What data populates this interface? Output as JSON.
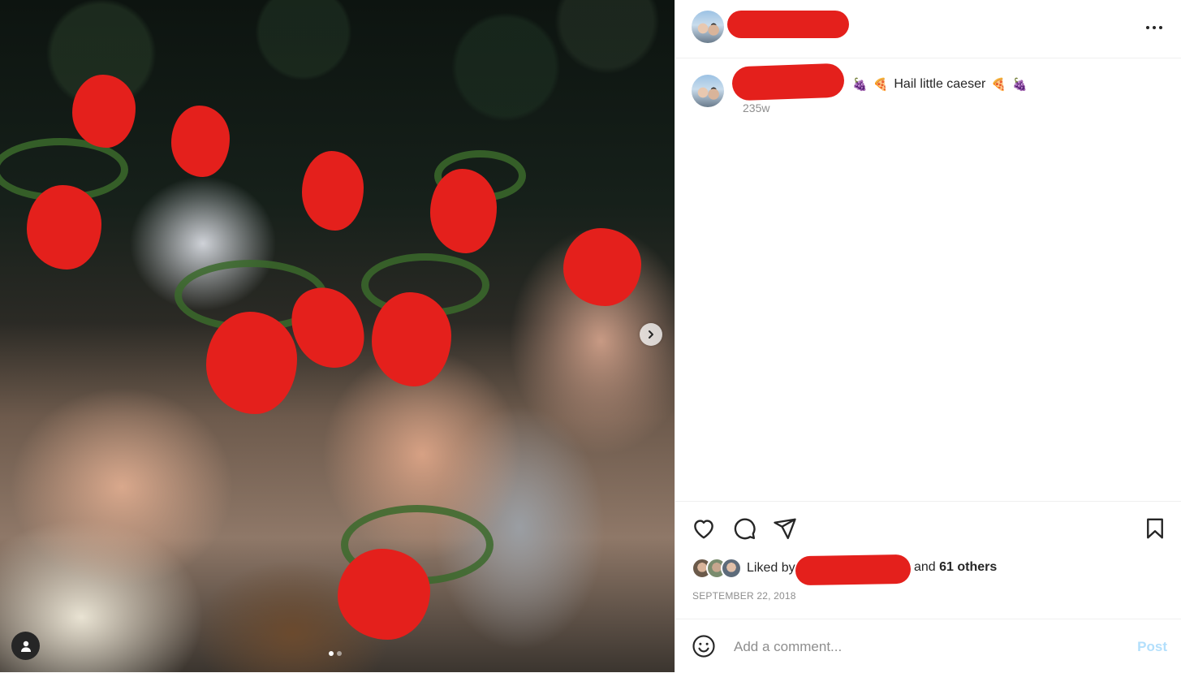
{
  "post": {
    "username": "",
    "caption": {
      "username": "",
      "emoji_lead": [
        "🍇",
        "🍕"
      ],
      "text": "Hail little caeser",
      "emoji_trail": [
        "🍕",
        "🍇"
      ],
      "age": "235w"
    },
    "likes": {
      "liked_by_prefix": "Liked by",
      "liked_by_user": "",
      "and_text": "and",
      "others_text": "61 others"
    },
    "date": "SEPTEMBER 22, 2018"
  },
  "carousel": {
    "slide_count": 2,
    "active_index": 0
  },
  "comment": {
    "placeholder": "Add a comment...",
    "post_label": "Post"
  },
  "colors": {
    "redaction": "#e4201c",
    "post_button_disabled": "#b2dffc",
    "muted_text": "#8e8e8e"
  },
  "icons": {
    "more": "more-horizontal-icon",
    "like": "heart-icon",
    "comment": "comment-icon",
    "share": "paper-plane-icon",
    "save": "bookmark-icon",
    "emoji": "smiley-icon",
    "tagged": "user-tag-icon",
    "next": "chevron-right-icon"
  }
}
